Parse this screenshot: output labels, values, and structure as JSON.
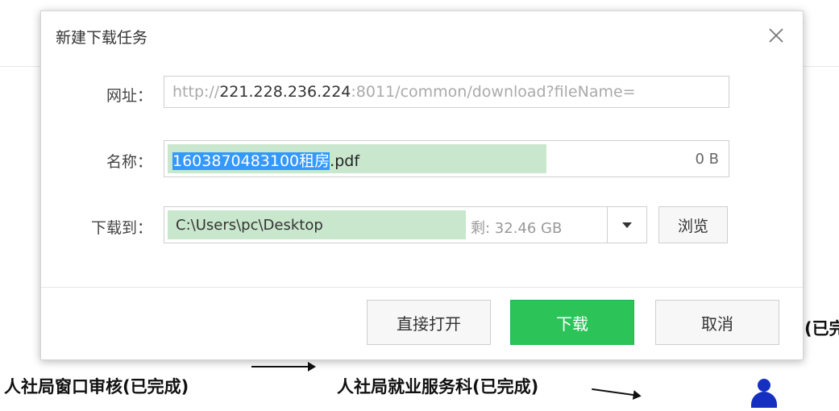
{
  "dialog": {
    "title": "新建下载任务",
    "url_label": "网址：",
    "url_prefix": "http://",
    "url_host": "221.228.236.224",
    "url_rest": ":8011/common/download?fileName=",
    "name_label": "名称：",
    "name_selected": "1603870483100租房",
    "name_ext": ".pdf",
    "name_size": "0 B",
    "dest_label": "下载到：",
    "dest_path": "C:\\Users\\pc\\Desktop",
    "dest_free": "剩: 32.46 GB",
    "browse_label": "浏览",
    "open_label": "直接打开",
    "download_label": "下载",
    "cancel_label": "取消"
  },
  "background": {
    "step1": "人社局窗口审核(已完成)",
    "step2": "人社局就业服务科(已完成)",
    "partial": "(已完"
  },
  "colors": {
    "download_button": "#2cc359",
    "progress_fill": "#c9e7cd",
    "selection": "#3399ff",
    "person_icon": "#1530c0"
  }
}
